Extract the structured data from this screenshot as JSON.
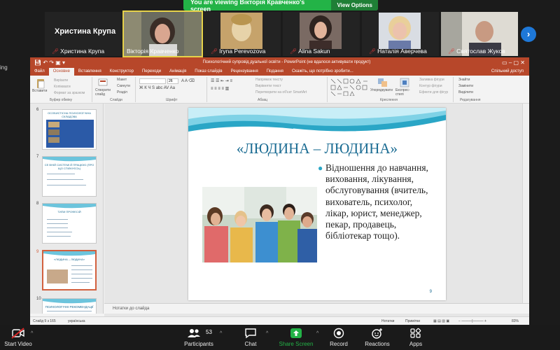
{
  "banner": {
    "text": "You are viewing Вікторія Кравченко's screen",
    "view_options": "View Options"
  },
  "participants": [
    {
      "name": "Христина Крупа",
      "big_name": "Христина Крупа",
      "muted": true
    },
    {
      "name": "Вікторія Кравченко",
      "muted": false,
      "active": true
    },
    {
      "name": "Iryna Perevozova",
      "muted": true
    },
    {
      "name": "Alina Sakun",
      "muted": true
    },
    {
      "name": "Наталія Аверчева",
      "muted": true
    },
    {
      "name": "Святослав Жуков",
      "muted": true
    }
  ],
  "left_edge_text": "ing",
  "ppt": {
    "window_title": "Психологічний супровід дуальної освіти - PowerPoint (не вдалося активувати продукт)",
    "tabs": [
      "Файл",
      "Основне",
      "Вставлення",
      "Конструктор",
      "Переходи",
      "Анімація",
      "Показ слайдів",
      "Рецензування",
      "Подання"
    ],
    "tell_me": "Скажіть, що потрібно зробити...",
    "share": "Спільний доступ",
    "ribbon": {
      "paste": "Вставити",
      "cut": "Вирізати",
      "copy": "Копіювати",
      "format_painter": "Формат за зразком",
      "clipboard": "Буфер обміну",
      "new_slide": "Створити слайд",
      "layout": "Макет",
      "reset": "Скинути",
      "section": "Розділ",
      "slides": "Слайди",
      "font_size": "26",
      "font": "Шрифт",
      "text_direction": "Напрямок тексту",
      "align_text": "Вирівняти текст",
      "smartart": "Перетворити на об'єкт SmartArt",
      "paragraph": "Абзац",
      "arrange": "Упорядкувати",
      "quick_styles": "Експрес-стилі",
      "shape_fill": "Заливка фігури",
      "shape_outline": "Контур фігури",
      "shape_effects": "Ефекти для фігур",
      "drawing": "Креслення",
      "find": "Знайти",
      "replace": "Замінити",
      "select": "Виділити",
      "editing": "Редагування"
    },
    "thumbnails": [
      {
        "num": "6",
        "title": "ОСОБИСТІСНА ПСИХОЛОГІЧНА СКЛАДОВА"
      },
      {
        "num": "7",
        "title": "СЕ ВНІЙ СИСТЕМІ Й ПРАЦЮЮ (ПРО ЩО СПІЛКУЄСЬ)"
      },
      {
        "num": "8",
        "title": "ТИПИ ПРОФЕСІЙ"
      },
      {
        "num": "9",
        "title": "«ЛЮДИНА – ЛЮДИНА»"
      },
      {
        "num": "10",
        "title": "ПСИХОЛОГІЧНІ РЕКОМЕНДАЦІЇ"
      }
    ],
    "slide": {
      "title": "«ЛЮДИНА – ЛЮДИНА»",
      "bullet": "Відношення до навчання, виховання, лікування, обслуговування (вчитель, вихователь, психолог, лікар, юрист, менеджер, пекар, продавець, бібліотекар тощо).",
      "number": "9"
    },
    "notes_placeholder": "Нотатки до слайда",
    "status": {
      "slide_info": "Слайд 9 з 165",
      "language": "українська",
      "notes": "Нотатки",
      "comments": "Примітки",
      "zoom": "83%"
    }
  },
  "toolbar": {
    "start_video": "Start Video",
    "participants": "Participants",
    "participants_count": "53",
    "chat": "Chat",
    "share_screen": "Share Screen",
    "record": "Record",
    "reactions": "Reactions",
    "apps": "Apps"
  }
}
